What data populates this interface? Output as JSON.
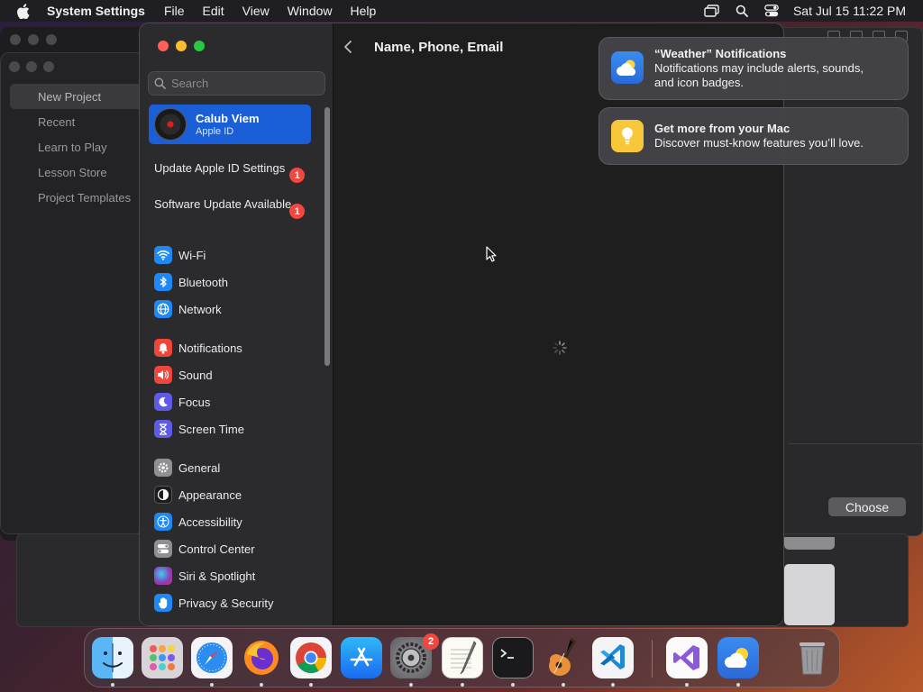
{
  "menubar": {
    "app_name": "System Settings",
    "menus": [
      "File",
      "Edit",
      "View",
      "Window",
      "Help"
    ],
    "clock": "Sat Jul 15  11:22 PM",
    "icons": [
      "screen-mirroring-icon",
      "spotlight-search-icon",
      "control-center-icon"
    ]
  },
  "background_window": {
    "items": [
      "New Project",
      "Recent",
      "Learn to Play",
      "Lesson Store",
      "Project Templates"
    ],
    "choose_label": "Choose"
  },
  "settings": {
    "search_placeholder": "Search",
    "account": {
      "name": "Calub Viem",
      "subtitle": "Apple ID"
    },
    "notices": [
      {
        "label": "Update Apple ID Settings",
        "count": "1"
      },
      {
        "label": "Software Update Available",
        "count": "1"
      }
    ],
    "groups": [
      [
        {
          "label": "Wi-Fi",
          "icon": "wifi-icon",
          "color": "#1e88f5"
        },
        {
          "label": "Bluetooth",
          "icon": "bluetooth-icon",
          "color": "#1e88f5"
        },
        {
          "label": "Network",
          "icon": "globe-icon",
          "color": "#1e88f5"
        }
      ],
      [
        {
          "label": "Notifications",
          "icon": "bell-icon",
          "color": "#f0453a"
        },
        {
          "label": "Sound",
          "icon": "speaker-icon",
          "color": "#f0453a"
        },
        {
          "label": "Focus",
          "icon": "moon-icon",
          "color": "#5e5ce6"
        },
        {
          "label": "Screen Time",
          "icon": "hourglass-icon",
          "color": "#5e5ce6"
        }
      ],
      [
        {
          "label": "General",
          "icon": "gear-icon",
          "color": "#8e8e93"
        },
        {
          "label": "Appearance",
          "icon": "appearance-icon",
          "color": "#1c1c1e"
        },
        {
          "label": "Accessibility",
          "icon": "accessibility-icon",
          "color": "#1e88f5"
        },
        {
          "label": "Control Center",
          "icon": "toggles-icon",
          "color": "#8e8e93"
        },
        {
          "label": "Siri & Spotlight",
          "icon": "siri-icon",
          "color": "#8a3ab9"
        },
        {
          "label": "Privacy & Security",
          "icon": "hand-icon",
          "color": "#1e88f5"
        }
      ]
    ],
    "content_title": "Name, Phone, Email"
  },
  "notifications": [
    {
      "title": "“Weather” Notifications",
      "lines": [
        "Notifications may include alerts, sounds,",
        "and icon badges."
      ],
      "icon": "weather-icon",
      "color": "#2f7fe8"
    },
    {
      "title": "Get more from your Mac",
      "lines": [
        "Discover must-know features you’ll love."
      ],
      "icon": "tips-lightbulb-icon",
      "color": "#f7c93a"
    }
  ],
  "dock": {
    "apps": [
      "Finder",
      "Launchpad",
      "Safari",
      "Firefox",
      "Chrome",
      "App Store",
      "System Settings",
      "TextEdit",
      "Terminal",
      "GarageBand",
      "Visual Studio Code",
      "Visual Studio",
      "Weather",
      "Trash"
    ],
    "system_settings_badge": "2"
  }
}
